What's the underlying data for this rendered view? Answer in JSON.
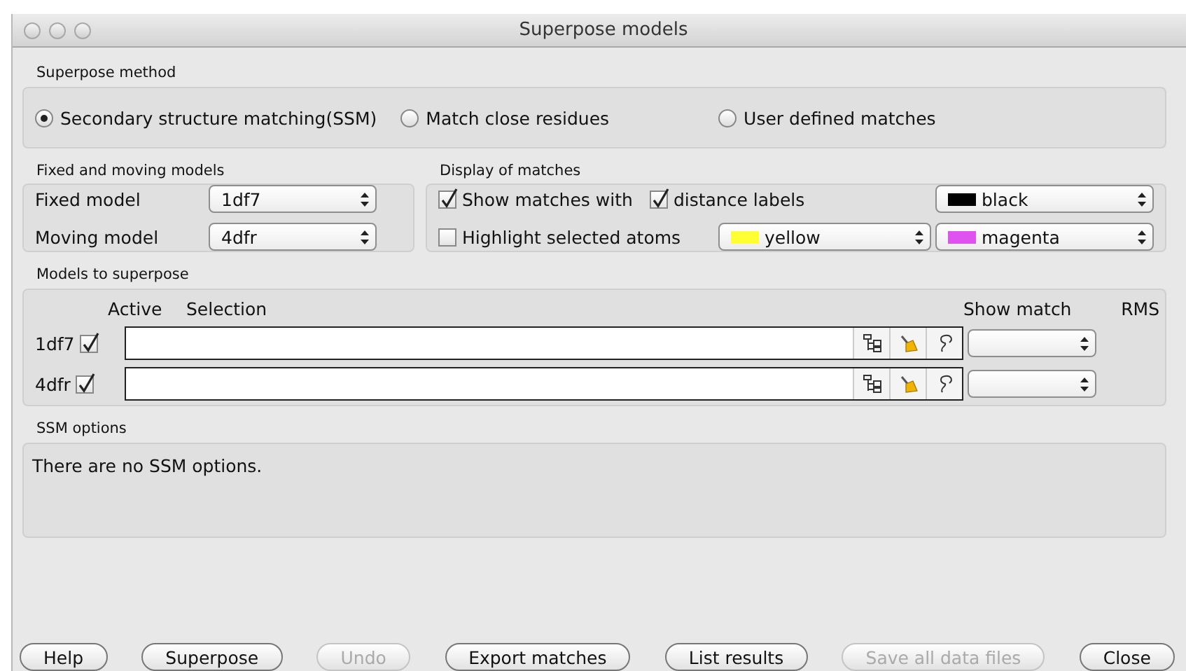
{
  "window": {
    "title": "Superpose models"
  },
  "method": {
    "heading": "Superpose method",
    "options": [
      {
        "label": "Secondary structure matching(SSM)",
        "selected": true
      },
      {
        "label": "Match close residues",
        "selected": false
      },
      {
        "label": "User defined matches",
        "selected": false
      }
    ]
  },
  "models": {
    "heading": "Fixed and moving models",
    "rows": [
      {
        "label": "Fixed model",
        "value": "1df7"
      },
      {
        "label": "Moving model",
        "value": "4dfr"
      }
    ]
  },
  "display": {
    "heading": "Display of matches",
    "show_matches": {
      "label": "Show matches with",
      "checked": true
    },
    "distance_labels": {
      "label": "distance labels",
      "checked": true
    },
    "match_color": {
      "value": "black",
      "color": "#000000"
    },
    "highlight": {
      "label": "Highlight selected atoms",
      "checked": false
    },
    "highlight_colors": [
      {
        "value": "yellow",
        "color": "#ffff33"
      },
      {
        "value": "magenta",
        "color": "#e052f0"
      }
    ]
  },
  "superpose": {
    "heading": "Models to superpose",
    "columns": [
      "Active",
      "Selection",
      "Show match",
      "RMS"
    ],
    "rows": [
      {
        "name": "1df7",
        "active": true
      },
      {
        "name": "4dfr",
        "active": true
      }
    ]
  },
  "ssm": {
    "heading": "SSM options",
    "text": "There are no SSM options."
  },
  "buttons": [
    {
      "label": "Help",
      "disabled": false
    },
    {
      "label": "Superpose",
      "disabled": false
    },
    {
      "label": "Undo",
      "disabled": true
    },
    {
      "label": "Export matches",
      "disabled": false
    },
    {
      "label": "List results",
      "disabled": false
    },
    {
      "label": "Save all data files",
      "disabled": true
    },
    {
      "label": "Close",
      "disabled": false
    }
  ]
}
